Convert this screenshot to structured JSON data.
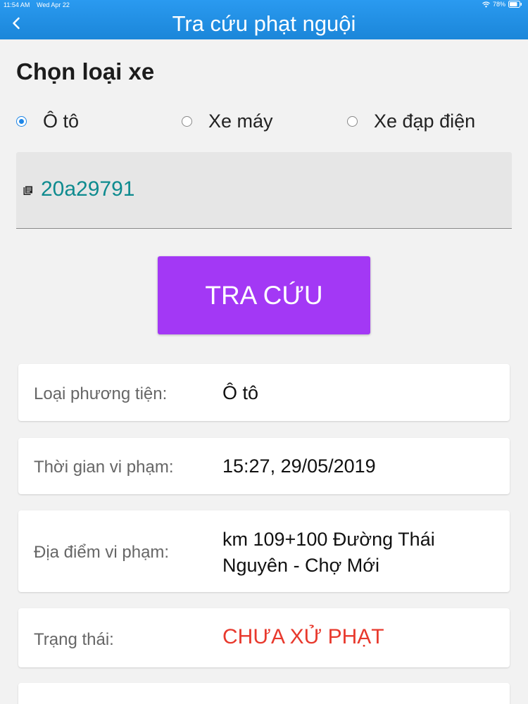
{
  "status_bar": {
    "time": "11:54 AM",
    "date": "Wed Apr 22",
    "battery": "78%"
  },
  "nav": {
    "title": "Tra cứu phạt nguội",
    "back_icon": "chevron-left-icon"
  },
  "section": {
    "title": "Chọn loại xe"
  },
  "vehicle_types": {
    "options": [
      {
        "label": "Ô tô",
        "selected": true
      },
      {
        "label": "Xe máy",
        "selected": false
      },
      {
        "label": "Xe đạp điện",
        "selected": false
      }
    ]
  },
  "plate": {
    "value": "20a29791",
    "icon": "document-icon"
  },
  "search": {
    "label": "TRA CỨU"
  },
  "results": {
    "vehicle": {
      "label": "Loại phương tiện:",
      "value": "Ô tô"
    },
    "time": {
      "label": "Thời gian vi phạm:",
      "value": "15:27, 29/05/2019"
    },
    "location": {
      "label": "Địa điểm vi phạm:",
      "line1": "km 109+100 Đường Thái",
      "line2": "Nguyên - Chợ Mới"
    },
    "status": {
      "label": "Trạng thái:",
      "value": "CHƯA XỬ PHẠT"
    }
  },
  "colors": {
    "header": "#1b86d9",
    "accent": "#1e86e6",
    "button": "#a338f5",
    "plate_text": "#0e8b8f",
    "status_red": "#e8392d"
  }
}
